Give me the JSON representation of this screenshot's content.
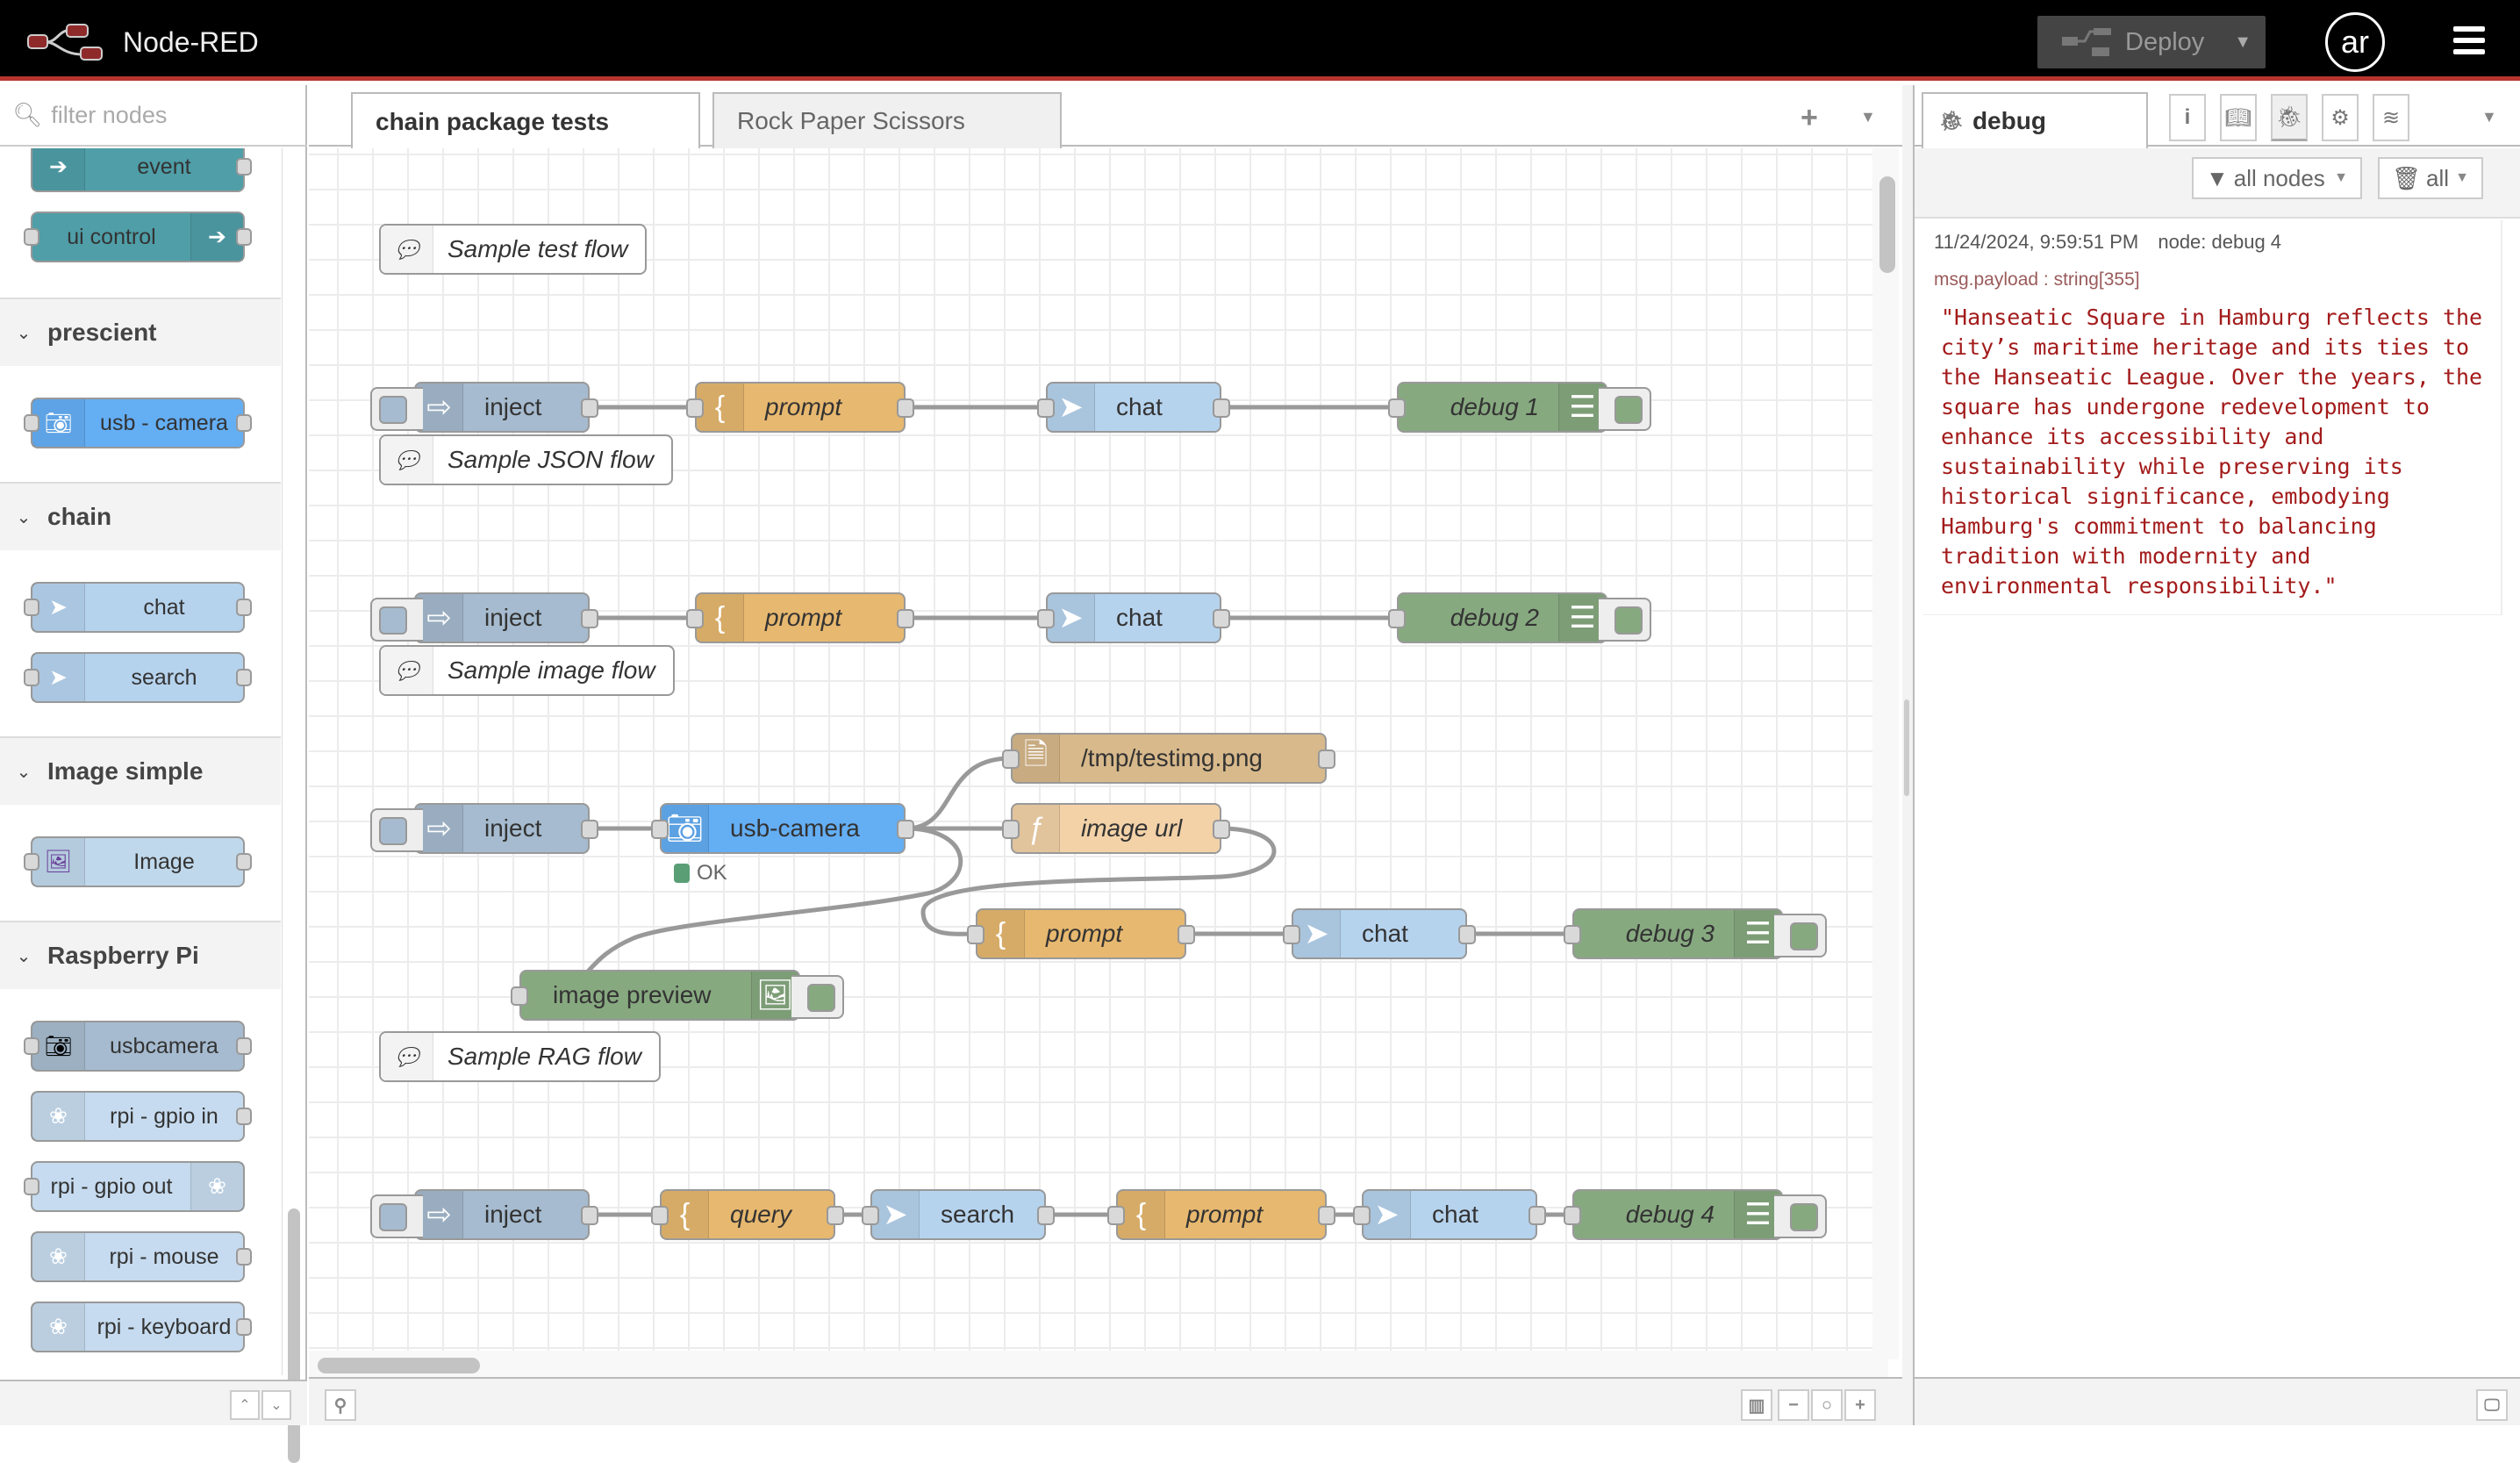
{
  "header": {
    "app_title": "Node-RED",
    "deploy_label": "Deploy",
    "user_initials": "ar",
    "colors": {
      "header_bg": "#000000",
      "accent": "#b7352e"
    }
  },
  "palette": {
    "filter_placeholder": "filter nodes",
    "items": {
      "event": "event",
      "ui_control": "ui control",
      "usb_camera": "usb - camera",
      "chat": "chat",
      "search": "search",
      "image": "Image",
      "usbcamera": "usbcamera",
      "gpio_in": "rpi - gpio in",
      "gpio_out": "rpi - gpio out",
      "mouse": "rpi - mouse",
      "keyboard": "rpi - keyboard"
    },
    "categories": {
      "prescient": "prescient",
      "chain": "chain",
      "image_simple": "Image simple",
      "raspberry_pi": "Raspberry Pi"
    }
  },
  "workspace": {
    "tabs": [
      {
        "label": "chain package tests",
        "active": true
      },
      {
        "label": "Rock Paper Scissors",
        "active": false
      }
    ],
    "flows": {
      "test": {
        "comment": "Sample test flow",
        "inject": "inject",
        "prompt": "prompt",
        "chat": "chat",
        "debug": "debug 1"
      },
      "json": {
        "comment": "Sample JSON flow",
        "inject": "inject",
        "prompt": "prompt",
        "chat": "chat",
        "debug": "debug 2"
      },
      "image": {
        "comment": "Sample image flow",
        "inject": "inject",
        "camera": "usb-camera",
        "camera_status": "OK",
        "file": "/tmp/testimg.png",
        "func": "image url",
        "preview": "image preview",
        "prompt": "prompt",
        "chat": "chat",
        "debug": "debug 3"
      },
      "rag": {
        "comment": "Sample RAG flow",
        "inject": "inject",
        "query": "query",
        "search": "search",
        "prompt": "prompt",
        "chat": "chat",
        "debug": "debug 4"
      }
    }
  },
  "sidebar": {
    "active_tab": "debug",
    "filter_label": "all nodes",
    "clear_label": "all",
    "message": {
      "timestamp": "11/24/2024, 9:59:51 PM",
      "node": "node: debug 4",
      "path": "msg.payload : string[355]",
      "value": "\"Hanseatic Square in Hamburg reflects the city’s maritime heritage and its ties to the Hanseatic League. Over the years, the square has undergone redevelopment to enhance its accessibility and sustainability while preserving its historical significance, embodying Hamburg's commitment to balancing tradition with modernity and environmental responsibility.\""
    }
  }
}
